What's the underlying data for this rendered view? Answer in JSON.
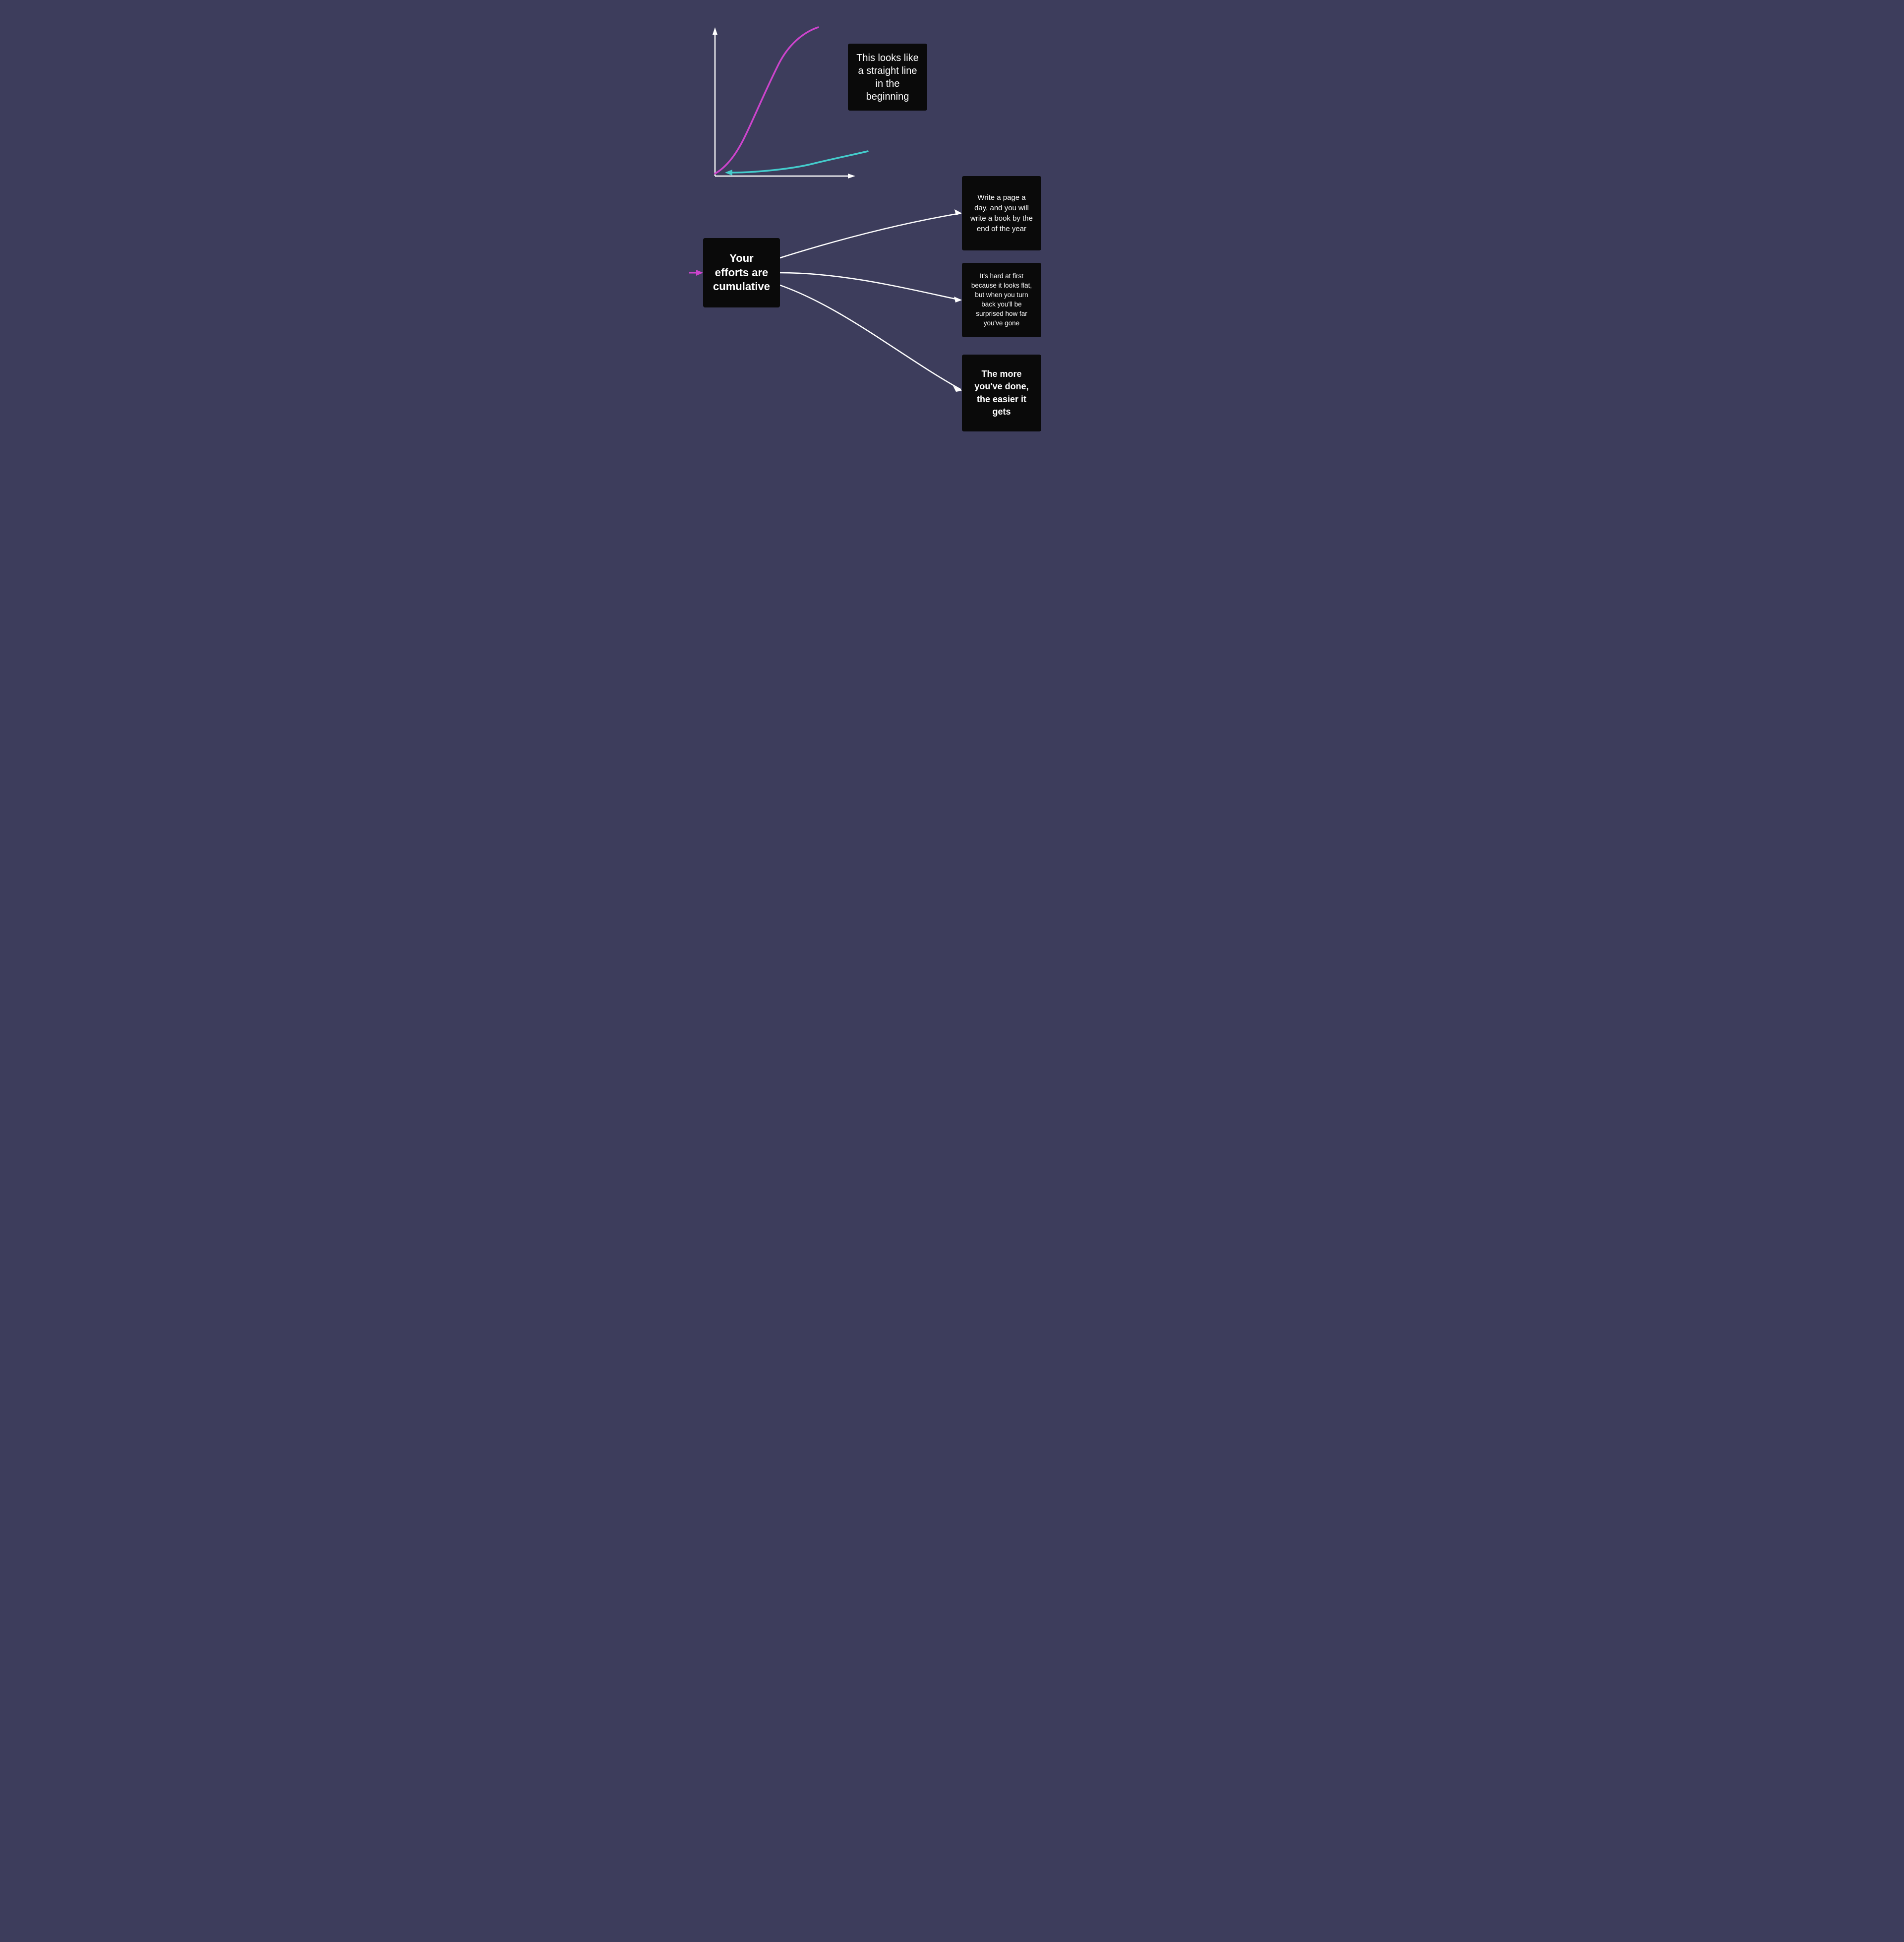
{
  "background_color": "#3d3d5c",
  "cards": {
    "straight_line": {
      "text": "This looks like a straight line in the beginning"
    },
    "efforts": {
      "text": "Your efforts are cumulative"
    },
    "page_a_day": {
      "text": "Write a page a day, and you will write a book by the end of the year"
    },
    "hard_at_first": {
      "text": "It's hard at first because it looks flat, but when you turn back you'll be surprised how far you've gone"
    },
    "more_youve_done": {
      "text": "The more you've done, the easier it gets"
    }
  },
  "colors": {
    "background": "#3d3d5c",
    "card": "#0a0a0a",
    "arrow_white": "#ffffff",
    "arrow_purple": "#cc44cc",
    "curve_purple": "#cc44cc",
    "curve_teal": "#44cccc"
  }
}
